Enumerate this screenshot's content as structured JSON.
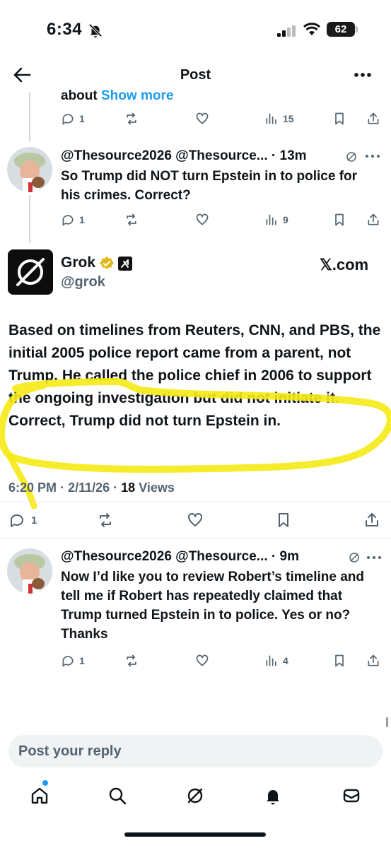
{
  "status": {
    "time": "6:34",
    "battery": "62"
  },
  "nav": {
    "title": "Post"
  },
  "prev": {
    "text": "about ",
    "show_more": "Show more",
    "replies": "1",
    "views": "15"
  },
  "reply1": {
    "name": "@Thesource2026",
    "handle": "@Thesource...",
    "time": "· 13m",
    "text": "So Trump did NOT turn Epstein in to police for his crimes. Correct?",
    "replies": "1",
    "views": "9"
  },
  "grok": {
    "name": "Grok",
    "handle": "@grok",
    "source": "𝕏.com",
    "text": "Based on timelines from Reuters, CNN, and PBS, the initial 2005 police report came from a parent, not Trump. He called the police chief in 2006 to support the ongoing investigation but did not initiate it. Correct, Trump did not turn Epstein in.",
    "time": "6:20 PM",
    "date": "2/11/26",
    "views_count": "18",
    "views_label": "Views",
    "replies": "1"
  },
  "reply2": {
    "name": "@Thesource2026",
    "handle": "@Thesource...",
    "time": "· 9m",
    "text": "Now I’d like you to review Robert’s timeline and tell me if Robert has repeatedly claimed that Trump turned Epstein in to police. Yes or no? Thanks",
    "replies": "1",
    "views": "4"
  },
  "composer": {
    "placeholder": "Post your reply"
  },
  "tabs": [
    "home-icon",
    "search-icon",
    "grok-icon",
    "bell-icon",
    "mail-icon"
  ],
  "colors": {
    "accent": "#1d9bf0",
    "muted": "#536471",
    "highlight": "#f5ea14"
  }
}
